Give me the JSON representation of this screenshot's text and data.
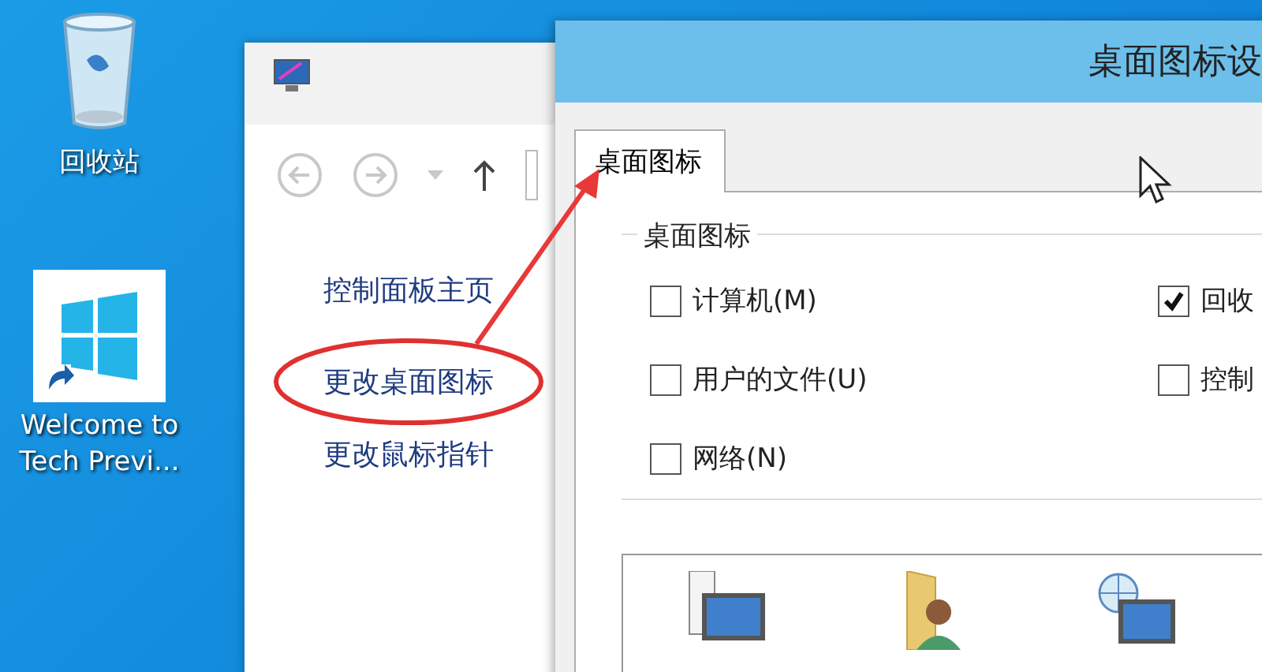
{
  "desktop_icons": [
    {
      "kind": "recycle-bin",
      "label": "回收站"
    },
    {
      "kind": "shortcut",
      "label": "Welcome to Tech Previ..."
    }
  ],
  "control_panel": {
    "links": [
      {
        "label": "控制面板主页",
        "circled": false
      },
      {
        "label": "更改桌面图标",
        "circled": true
      },
      {
        "label": "更改鼠标指针",
        "circled": false
      }
    ]
  },
  "dialog": {
    "title": "桌面图标设",
    "tabs": [
      {
        "label": "桌面图标",
        "selected": true
      }
    ],
    "group": {
      "title": "桌面图标",
      "checkboxes": [
        {
          "label": "计算机(M)",
          "checked": false
        },
        {
          "label": "回收",
          "checked": true
        },
        {
          "label": "用户的文件(U)",
          "checked": false
        },
        {
          "label": "控制",
          "checked": false
        },
        {
          "label": "网络(N)",
          "checked": false
        }
      ]
    },
    "icons": [
      {
        "kind": "computer"
      },
      {
        "kind": "user-folder"
      },
      {
        "kind": "network"
      }
    ]
  }
}
